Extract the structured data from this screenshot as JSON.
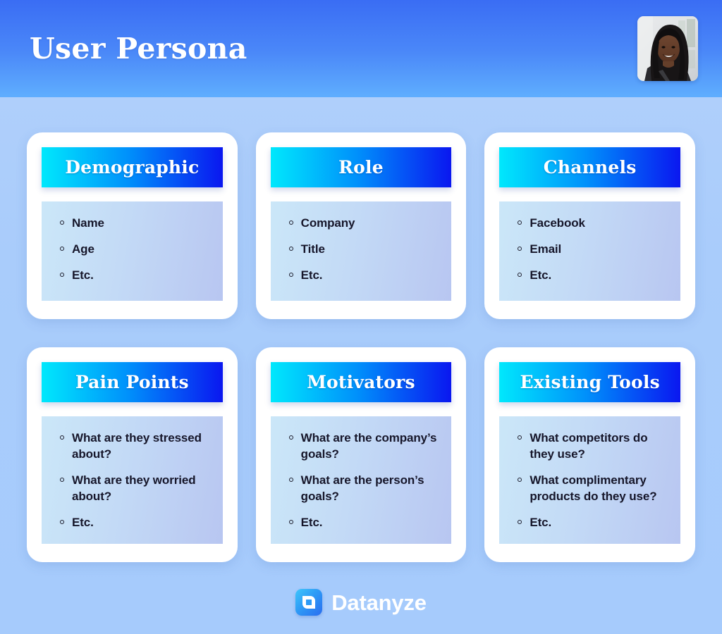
{
  "header": {
    "title": "User Persona",
    "avatar_alt": "persona-photo",
    "gradient_top": "#3a6df4",
    "gradient_bottom": "#5faefe"
  },
  "theme": {
    "page_background": "#a9ccfb",
    "card_background": "#ffffff",
    "card_header_gradient_start": "#00e8fc",
    "card_header_gradient_end": "#0a17f0",
    "card_body_gradient_start": "#cbe7f8",
    "card_body_gradient_end": "#b8c6f1",
    "text_color": "#16162a"
  },
  "cards": [
    {
      "title": "Demographic",
      "items": [
        "Name",
        "Age",
        "Etc."
      ]
    },
    {
      "title": "Role",
      "items": [
        "Company",
        "Title",
        "Etc."
      ]
    },
    {
      "title": "Channels",
      "items": [
        "Facebook",
        "Email",
        "Etc."
      ]
    },
    {
      "title": "Pain Points",
      "items": [
        "What are they stressed about?",
        "What are they worried about?",
        "Etc."
      ]
    },
    {
      "title": "Motivators",
      "items": [
        "What are the company’s goals?",
        "What are the person’s goals?",
        "Etc."
      ]
    },
    {
      "title": "Existing Tools",
      "items": [
        "What competitors do they use?",
        "What complimentary products do they use?",
        "Etc."
      ]
    }
  ],
  "footer": {
    "brand": "Datanyze",
    "logo_icon": "datanyze-logo-icon"
  }
}
